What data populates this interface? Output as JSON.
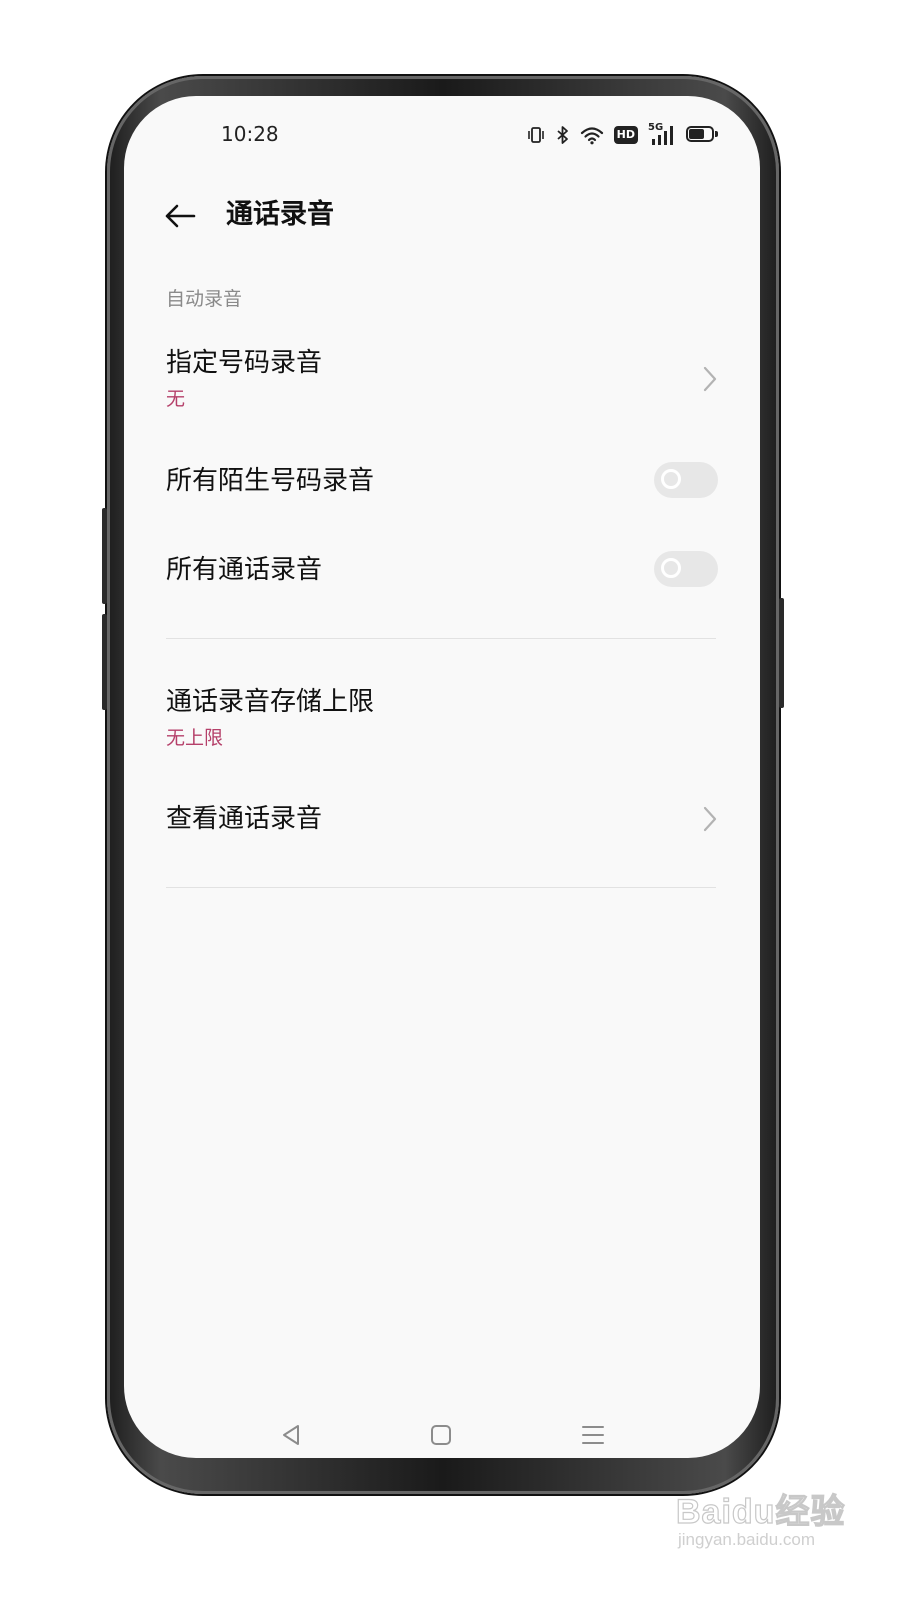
{
  "status_bar": {
    "time": "10:28",
    "icons": [
      "vibrate-icon",
      "bluetooth-icon",
      "wifi-icon",
      "hd-icon",
      "5g-signal-icon",
      "battery-icon"
    ],
    "hd_text": "HD",
    "network_text": "5G",
    "battery_level": 0.7
  },
  "header": {
    "back_icon": "back-arrow-icon",
    "title": "通话录音"
  },
  "section": {
    "label": "自动录音"
  },
  "rows": {
    "specified_numbers": {
      "title": "指定号码录音",
      "value": "无"
    },
    "unknown_numbers": {
      "title": "所有陌生号码录音",
      "enabled": false
    },
    "all_calls": {
      "title": "所有通话录音",
      "enabled": false
    },
    "storage_limit": {
      "title": "通话录音存储上限",
      "value": "无上限"
    },
    "view_recordings": {
      "title": "查看通话录音"
    }
  },
  "nav_bar": {
    "items": [
      "back-triangle-icon",
      "home-square-icon",
      "menu-lines-icon"
    ]
  },
  "colors": {
    "accent": "#b5406a",
    "screen_bg": "#f9f9f9",
    "toggle_off": "#e7e7e7"
  },
  "watermark": {
    "logo": "Baidu经验",
    "url": "jingyan.baidu.com"
  }
}
